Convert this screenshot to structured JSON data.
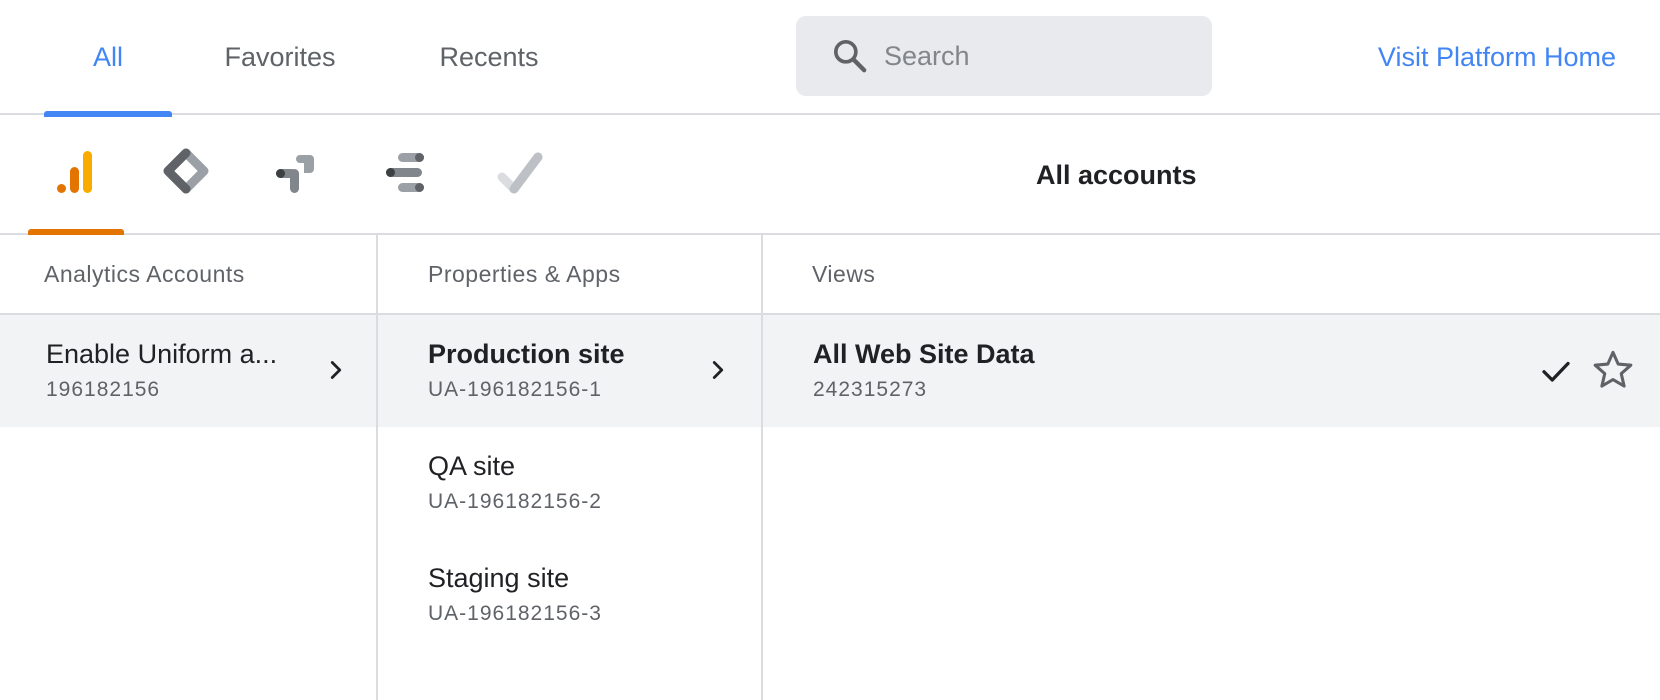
{
  "tabs": [
    {
      "label": "All",
      "active": true
    },
    {
      "label": "Favorites",
      "active": false
    },
    {
      "label": "Recents",
      "active": false
    }
  ],
  "search": {
    "placeholder": "Search",
    "icon": "search-icon"
  },
  "platform_link": "Visit Platform Home",
  "products": [
    {
      "name": "analytics-icon",
      "selected": true
    },
    {
      "name": "tag-manager-icon",
      "selected": false
    },
    {
      "name": "optimize-icon",
      "selected": false
    },
    {
      "name": "data-studio-icon",
      "selected": false
    },
    {
      "name": "surveys-icon",
      "selected": false
    }
  ],
  "scope_title": "All accounts",
  "columns": {
    "accounts": {
      "header": "Analytics Accounts",
      "items": [
        {
          "name": "Enable Uniform a...",
          "id": "196182156",
          "selected": true
        }
      ]
    },
    "properties": {
      "header": "Properties & Apps",
      "items": [
        {
          "name": "Production site",
          "id": "UA-196182156-1",
          "selected": true
        },
        {
          "name": "QA site",
          "id": "UA-196182156-2",
          "selected": false
        },
        {
          "name": "Staging site",
          "id": "UA-196182156-3",
          "selected": false
        }
      ]
    },
    "views": {
      "header": "Views",
      "items": [
        {
          "name": "All Web Site Data",
          "id": "242315273",
          "selected": true
        }
      ]
    }
  },
  "colors": {
    "accent_blue": "#4285f4",
    "analytics_orange": "#e37400",
    "selected_row": "#f1f3f4",
    "divider": "#dadce0"
  }
}
